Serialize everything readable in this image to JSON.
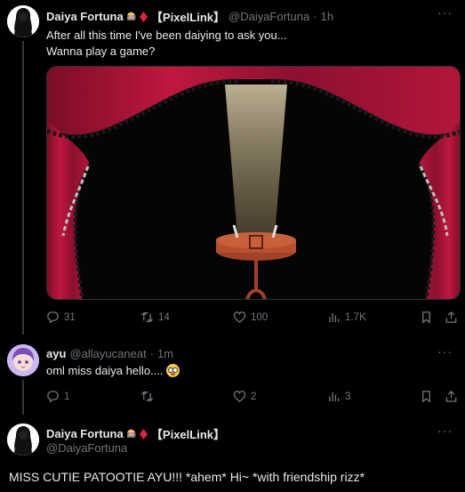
{
  "post1": {
    "display_name": "Daiya Fortuna",
    "badge_text": "🎰",
    "affiliation": "【PixelLink】",
    "handle": "@DaiyaFortuna",
    "separator": "·",
    "time": "1h",
    "text_line1": "After all this time I've been daiying to ask you...",
    "text_line2": "Wanna play a game?",
    "more_icon": "more-horizontal-icon",
    "media_description_icon": "theater-curtain-spotlight-image",
    "actions": {
      "replies": "31",
      "reposts": "14",
      "likes": "100",
      "views": "1.7K"
    }
  },
  "post2": {
    "display_name": "ayu",
    "handle": "@allayucaneat",
    "separator": "·",
    "time": "1m",
    "text": "oml miss daiya hello....",
    "emoji_icon": "flushed-face-emoji",
    "actions": {
      "replies": "1",
      "reposts": "",
      "likes": "2",
      "views": "3"
    }
  },
  "post3": {
    "display_name": "Daiya Fortuna",
    "badge_text": "🎰",
    "affiliation": "【PixelLink】",
    "handle": "@DaiyaFortuna",
    "text": "MISS CUTIE PATOOTIE AYU!!! *ahem* Hi~ *with friendship rizz*"
  },
  "colors": {
    "background": "#000000",
    "text": "#e7e9ea",
    "muted": "#71767b",
    "divider": "#2f3336",
    "gem_red": "#e0243a",
    "curtain_red": "#b4163a"
  }
}
